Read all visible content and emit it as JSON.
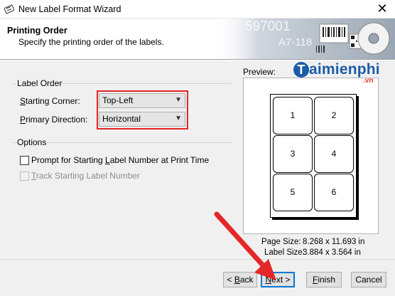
{
  "window": {
    "title": "New Label Format Wizard",
    "close_glyph": "✕",
    "icon": "label-wizard-icon"
  },
  "header": {
    "title": "Printing Order",
    "subtitle": "Specify the printing order of the labels.",
    "art_text": [
      "597001",
      "A7-118"
    ]
  },
  "label_order": {
    "section_title": "Label Order",
    "starting_corner": {
      "label_u": "S",
      "label_rest": "tarting Corner:",
      "value": "Top-Left"
    },
    "primary_direction": {
      "label_u": "P",
      "label_rest": "rimary Direction:",
      "value": "Horizontal"
    }
  },
  "options": {
    "section_title": "Options",
    "prompt_checkbox": {
      "label_pre": "Prompt for Starting ",
      "label_u": "L",
      "label_rest": "abel Number at Print Time",
      "checked": false
    },
    "track_checkbox": {
      "label_u": "T",
      "label_rest": "rack Starting Label Number",
      "checked": false,
      "disabled": true
    }
  },
  "preview": {
    "label": "Preview:",
    "cells": [
      "1",
      "2",
      "3",
      "4",
      "5",
      "6"
    ],
    "page_size_label": "Page Size:",
    "page_size_value": "8.268 x 11.693 in",
    "label_size_label": "Label Size:",
    "label_size_value": "3.884 x 3.564 in"
  },
  "buttons": {
    "back": {
      "prefix": "< ",
      "u": "B",
      "rest": "ack"
    },
    "next": {
      "u": "N",
      "rest": "ext",
      "suffix": " >"
    },
    "finish": {
      "u": "F",
      "rest": "inish"
    },
    "cancel": "Cancel"
  },
  "watermark": {
    "main": "aimienphi",
    "t": "T",
    "suffix": ".vn"
  },
  "colors": {
    "highlight_red": "#e52629",
    "accent_blue": "#0078d7",
    "watermark_blue": "#1b5ca8"
  }
}
